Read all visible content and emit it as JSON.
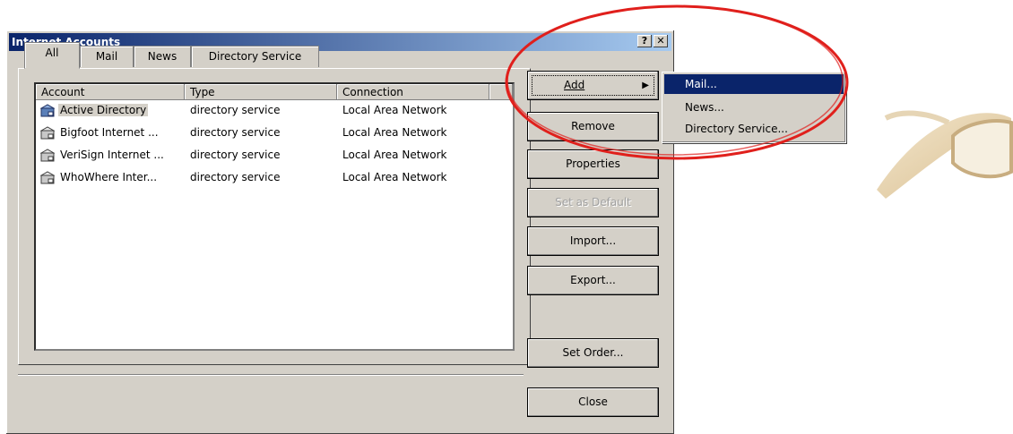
{
  "window": {
    "title": "Internet Accounts",
    "help_btn": "?",
    "close_btn": "✕"
  },
  "tabs": [
    {
      "label": "All"
    },
    {
      "label": "Mail"
    },
    {
      "label": "News"
    },
    {
      "label": "Directory Service"
    }
  ],
  "list": {
    "columns": [
      "Account",
      "Type",
      "Connection"
    ],
    "rows": [
      {
        "account": "Active Directory",
        "type": "directory service",
        "connection": "Local Area Network",
        "selected": true,
        "icon": "directory-service-icon"
      },
      {
        "account": "Bigfoot Internet ...",
        "type": "directory service",
        "connection": "Local Area Network",
        "icon": "directory-service-icon"
      },
      {
        "account": "VeriSign Internet ...",
        "type": "directory service",
        "connection": "Local Area Network",
        "icon": "directory-service-icon"
      },
      {
        "account": "WhoWhere Inter...",
        "type": "directory service",
        "connection": "Local Area Network",
        "icon": "directory-service-icon"
      }
    ]
  },
  "buttons": {
    "add": "Add",
    "remove": "Remove",
    "properties": "Properties",
    "set_default": "Set as Default",
    "import": "Import...",
    "export": "Export...",
    "set_order": "Set Order...",
    "close": "Close"
  },
  "add_menu": {
    "items": [
      "Mail...",
      "News...",
      "Directory Service..."
    ],
    "highlighted": "Mail..."
  },
  "colors": {
    "titlebar_start": "#0a246a",
    "titlebar_end": "#a6caf0",
    "face": "#d4d0c8",
    "highlight": "#0a246a",
    "annotation_ellipse": "#e0201c"
  }
}
